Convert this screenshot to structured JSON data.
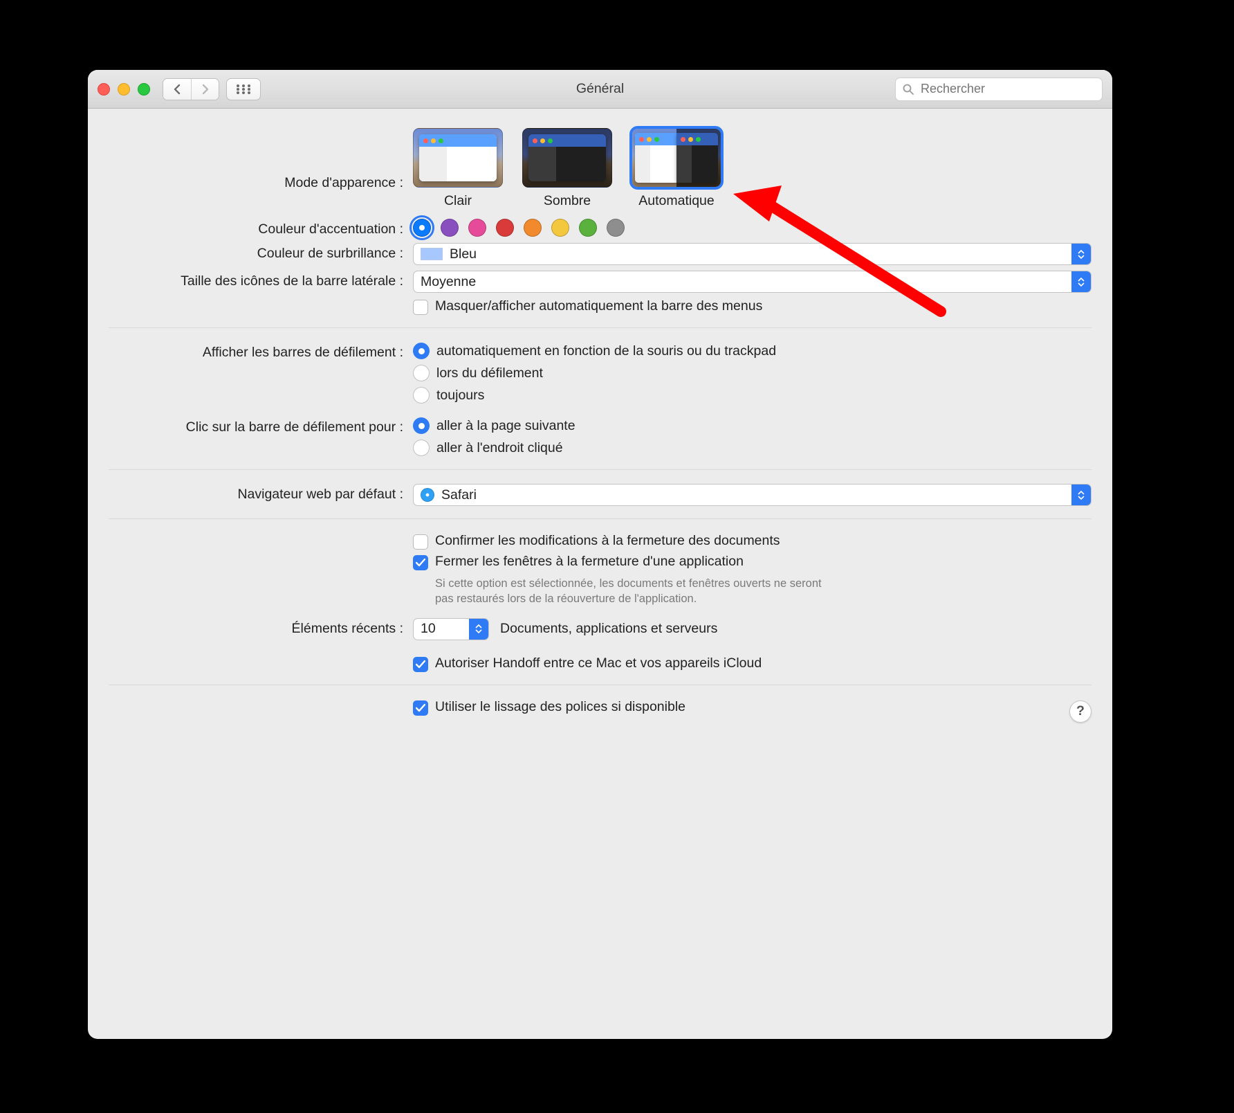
{
  "window": {
    "title": "Général"
  },
  "toolbar": {
    "search_placeholder": "Rechercher"
  },
  "appearance": {
    "label": "Mode d'apparence :",
    "options": [
      "Clair",
      "Sombre",
      "Automatique"
    ],
    "selected_index": 2
  },
  "accent": {
    "label": "Couleur d'accentuation :",
    "colors": [
      "#0a7aff",
      "#8a4fbf",
      "#e64b9a",
      "#d93b3b",
      "#f08a2d",
      "#f3c73e",
      "#5bb13d",
      "#8e8e8e"
    ],
    "selected_index": 0
  },
  "highlight": {
    "label": "Couleur de surbrillance :",
    "value": "Bleu",
    "swatch": "#a7c8ff"
  },
  "sidebar_icon": {
    "label": "Taille des icônes de la barre latérale :",
    "value": "Moyenne"
  },
  "menubar_autohide": {
    "label": "Masquer/afficher automatiquement la barre des menus",
    "checked": false
  },
  "scrollbars": {
    "label": "Afficher les barres de défilement :",
    "options": [
      "automatiquement en fonction de la souris ou du trackpad",
      "lors du défilement",
      "toujours"
    ],
    "selected_index": 0
  },
  "scroll_click": {
    "label": "Clic sur la barre de défilement pour :",
    "options": [
      "aller à la page suivante",
      "aller à l'endroit cliqué"
    ],
    "selected_index": 0
  },
  "browser": {
    "label": "Navigateur web par défaut :",
    "value": "Safari"
  },
  "confirm_changes": {
    "label": "Confirmer les modifications à la fermeture des documents",
    "checked": false
  },
  "close_windows": {
    "label": "Fermer les fenêtres à la fermeture d'une application",
    "hint": "Si cette option est sélectionnée, les documents et fenêtres ouverts ne seront pas restaurés lors de la réouverture de l'application.",
    "checked": true
  },
  "recent": {
    "label": "Éléments récents :",
    "value": "10",
    "suffix": "Documents, applications et serveurs"
  },
  "handoff": {
    "label": "Autoriser Handoff entre ce Mac et vos appareils iCloud",
    "checked": true
  },
  "font_smoothing": {
    "label": "Utiliser le lissage des polices si disponible",
    "checked": true
  },
  "help": "?"
}
